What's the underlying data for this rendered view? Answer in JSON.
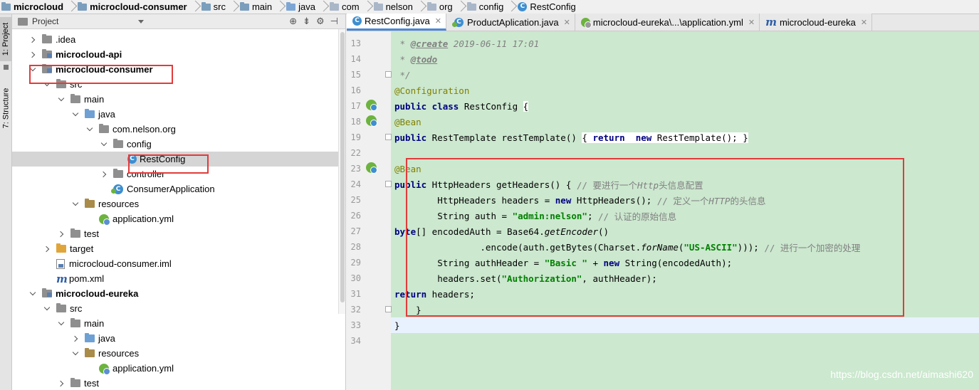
{
  "breadcrumb": [
    {
      "label": "microcloud",
      "icon": "module-folder-icon",
      "bold": true
    },
    {
      "label": "microcloud-consumer",
      "icon": "module-folder-icon",
      "bold": true
    },
    {
      "label": "src",
      "icon": "folder-icon",
      "bold": false
    },
    {
      "label": "main",
      "icon": "folder-icon",
      "bold": false
    },
    {
      "label": "java",
      "icon": "source-folder-icon",
      "bold": false
    },
    {
      "label": "com",
      "icon": "package-icon",
      "bold": false
    },
    {
      "label": "nelson",
      "icon": "package-icon",
      "bold": false
    },
    {
      "label": "org",
      "icon": "package-icon",
      "bold": false
    },
    {
      "label": "config",
      "icon": "package-icon",
      "bold": false
    },
    {
      "label": "RestConfig",
      "icon": "class-icon",
      "bold": false
    }
  ],
  "toolstrip": {
    "project_tab": "1: Project",
    "structure_tab": "7: Structure"
  },
  "project_panel": {
    "title": "Project",
    "tools": [
      "target-icon",
      "collapse-icon",
      "gear-icon",
      "hide-icon"
    ],
    "tree": [
      {
        "label": ".idea",
        "depth": 0,
        "arrow": "right",
        "icon": "folder-gray",
        "bold": false
      },
      {
        "label": "microcloud-api",
        "depth": 0,
        "arrow": "right",
        "icon": "module",
        "bold": true
      },
      {
        "label": "microcloud-consumer",
        "depth": 0,
        "arrow": "down",
        "icon": "module",
        "bold": true
      },
      {
        "label": "src",
        "depth": 1,
        "arrow": "down",
        "icon": "folder-gray",
        "bold": false
      },
      {
        "label": "main",
        "depth": 2,
        "arrow": "down",
        "icon": "folder-gray",
        "bold": false
      },
      {
        "label": "java",
        "depth": 3,
        "arrow": "down",
        "icon": "folder-blue",
        "bold": false
      },
      {
        "label": "com.nelson.org",
        "depth": 4,
        "arrow": "down",
        "icon": "folder-gray",
        "bold": false
      },
      {
        "label": "config",
        "depth": 5,
        "arrow": "down",
        "icon": "folder-gray",
        "bold": false
      },
      {
        "label": "RestConfig",
        "depth": 6,
        "arrow": "none",
        "icon": "class",
        "bold": false,
        "selected": true
      },
      {
        "label": "controller",
        "depth": 5,
        "arrow": "right",
        "icon": "folder-gray",
        "bold": false
      },
      {
        "label": "ConsumerApplication",
        "depth": 5,
        "arrow": "none",
        "icon": "spring-class",
        "bold": false
      },
      {
        "label": "resources",
        "depth": 3,
        "arrow": "down",
        "icon": "folder-res",
        "bold": false
      },
      {
        "label": "application.yml",
        "depth": 4,
        "arrow": "none",
        "icon": "yml",
        "bold": false
      },
      {
        "label": "test",
        "depth": 2,
        "arrow": "right",
        "icon": "folder-gray",
        "bold": false
      },
      {
        "label": "target",
        "depth": 1,
        "arrow": "right",
        "icon": "folder-orange",
        "bold": false,
        "highlight": true
      },
      {
        "label": "microcloud-consumer.iml",
        "depth": 1,
        "arrow": "none",
        "icon": "iml",
        "bold": false
      },
      {
        "label": "pom.xml",
        "depth": 1,
        "arrow": "none",
        "icon": "maven",
        "bold": false
      },
      {
        "label": "microcloud-eureka",
        "depth": 0,
        "arrow": "down",
        "icon": "module",
        "bold": true
      },
      {
        "label": "src",
        "depth": 1,
        "arrow": "down",
        "icon": "folder-gray",
        "bold": false
      },
      {
        "label": "main",
        "depth": 2,
        "arrow": "down",
        "icon": "folder-gray",
        "bold": false
      },
      {
        "label": "java",
        "depth": 3,
        "arrow": "right",
        "icon": "folder-blue",
        "bold": false
      },
      {
        "label": "resources",
        "depth": 3,
        "arrow": "down",
        "icon": "folder-res",
        "bold": false
      },
      {
        "label": "application.yml",
        "depth": 4,
        "arrow": "none",
        "icon": "yml",
        "bold": false
      },
      {
        "label": "test",
        "depth": 2,
        "arrow": "right",
        "icon": "folder-gray",
        "bold": false
      }
    ]
  },
  "editor_tabs": [
    {
      "label": "RestConfig.java",
      "icon": "class-icon",
      "active": true
    },
    {
      "label": "ProductAplication.java",
      "icon": "spring-class-icon",
      "active": false
    },
    {
      "label": "microcloud-eureka\\...\\application.yml",
      "icon": "yml-icon",
      "active": false
    },
    {
      "label": "microcloud-eureka",
      "icon": "maven-icon",
      "active": false
    }
  ],
  "code_lines": [
    {
      "n": "13",
      "html": "<span class=\"cmt\"> * </span><span class=\"doctag\">@create</span><span class=\"cmt\"> 2019-06-11 17:01</span>"
    },
    {
      "n": "14",
      "html": "<span class=\"cmt\"> * </span><span class=\"doctag\">@todo</span>"
    },
    {
      "n": "15",
      "html": "<span class=\"cmt\"> */</span>"
    },
    {
      "n": "16",
      "html": "<span class=\"ann\">@Configuration</span>"
    },
    {
      "n": "17",
      "html": "<span class=\"kw\">public class</span> RestConfig <span class=\"bk\">{</span>"
    },
    {
      "n": "18",
      "html": "    <span class=\"ann\">@Bean</span>"
    },
    {
      "n": "19",
      "html": "    <span class=\"kw\">public</span> RestTemplate restTemplate() <span class=\"bk\">{ <span class=\"kw\">return</span>  <span class=\"kw\">new</span> RestTemplate(); }</span>"
    },
    {
      "n": "22",
      "html": ""
    },
    {
      "n": "23",
      "html": "    <span class=\"ann\">@Bean</span>"
    },
    {
      "n": "24",
      "html": "    <span class=\"kw\">public</span> HttpHeaders getHeaders() { <span class=\"cmt2\">// 要进行一个<span class=\"it\">Http</span>头信息配置</span>"
    },
    {
      "n": "25",
      "html": "        HttpHeaders headers = <span class=\"kw\">new</span> HttpHeaders(); <span class=\"cmt2\">// 定义一个<span class=\"it\">HTTP</span>的头信息</span>"
    },
    {
      "n": "26",
      "html": "        String auth = <span class=\"str\">\"admin:nelson\"</span>; <span class=\"cmt2\">// 认证的原始信息</span>"
    },
    {
      "n": "27",
      "html": "        <span class=\"kw\">byte</span>[] encodedAuth = Base64.<span class=\"it\">getEncoder</span>()"
    },
    {
      "n": "28",
      "html": "                .encode(auth.getBytes(Charset.<span class=\"it\">forName</span>(<span class=\"str\">\"US-ASCII\"</span>))); <span class=\"cmt2\">// 进行一个加密的处理</span>"
    },
    {
      "n": "29",
      "html": "        String authHeader = <span class=\"str\">\"Basic \"</span> + <span class=\"kw\">new</span> String(encodedAuth);"
    },
    {
      "n": "30",
      "html": "        headers.set(<span class=\"str\">\"Authorization\"</span>, authHeader);"
    },
    {
      "n": "31",
      "html": "        <span class=\"kw\">return</span> headers;"
    },
    {
      "n": "32",
      "html": "    }"
    },
    {
      "n": "33",
      "html": "}",
      "current": true
    },
    {
      "n": "34",
      "html": ""
    }
  ],
  "watermark": "https://blog.csdn.net/aimashi620"
}
